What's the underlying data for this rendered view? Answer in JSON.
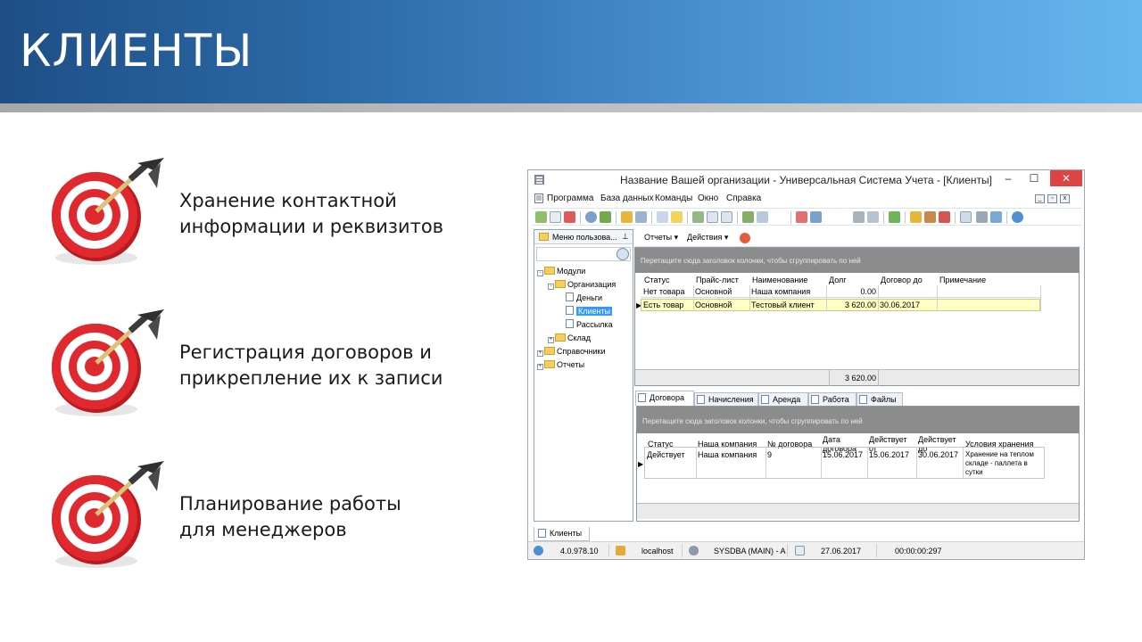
{
  "slide": {
    "title": "КЛИЕНТЫ"
  },
  "bullets": [
    {
      "line1": "Хранение контактной",
      "line2": "информации и реквизитов"
    },
    {
      "line1": "Регистрация договоров и",
      "line2": "прикрепление их к записи"
    },
    {
      "line1": "Планирование работы",
      "line2": "для менеджеров"
    }
  ],
  "window": {
    "title": "Название Вашей организации - Универсальная Система Учета - [Клиенты]",
    "minimize": "–",
    "maximize": "☐",
    "close": "✕",
    "menu": [
      "Программа",
      "База данных",
      "Команды",
      "Окно",
      "Справка"
    ]
  },
  "nav": {
    "header": "Меню пользова...",
    "tree": [
      {
        "label": "Модули"
      },
      {
        "label": "Организация"
      },
      {
        "label": "Деньги"
      },
      {
        "label": "Клиенты"
      },
      {
        "label": "Рассылка"
      },
      {
        "label": "Склад"
      },
      {
        "label": "Справочники"
      },
      {
        "label": "Отчеты"
      }
    ]
  },
  "subtoolbar": {
    "reports": "Отчеты ▾",
    "actions": "Действия ▾"
  },
  "grid1": {
    "group_hint": "Перетащите сюда заголовок колонки, чтобы сгруппировать по ней",
    "columns": [
      "Статус",
      "Прайс-лист",
      "Наименование",
      "Долг",
      "Договор до",
      "Примечание"
    ],
    "rows": [
      {
        "status": "Нет товара",
        "price": "Основной",
        "name": "Наша компания",
        "debt": "0.00",
        "contract": "",
        "note": ""
      },
      {
        "status": "Есть товар",
        "price": "Основной",
        "name": "Тестовый клиент",
        "debt": "3 620.00",
        "contract": "30.06.2017",
        "note": ""
      }
    ],
    "total": "3 620.00"
  },
  "detail_tabs": [
    "Договора",
    "Начисления",
    "Аренда",
    "Работа",
    "Файлы"
  ],
  "grid2": {
    "group_hint": "Перетащите сюда заголовок колонки, чтобы сгруппировать по ней",
    "columns": {
      "status": "Статус",
      "company": "Наша компания",
      "number": "№ договора",
      "date1": "Дата",
      "date2": "договора",
      "from1": "Действует",
      "from2": "от",
      "to1": "Действует",
      "to2": "до",
      "conditions": "Условия хранения"
    },
    "row": {
      "status": "Действует",
      "company": "Наша компания",
      "number": "9",
      "date": "15.06.2017",
      "from": "15.06.2017",
      "to": "30.06.2017",
      "cond1": "Хранение на теплом",
      "cond2": "складе - паллета в",
      "cond3": "сутки"
    }
  },
  "bottom_tab": "Клиенты",
  "status": {
    "version": "4.0.978.10",
    "host": "localhost",
    "user": "SYSDBA (MAIN) - A",
    "date": "27.06.2017",
    "time": "00:00:00:297"
  },
  "colors": {
    "header_start": "#1e4f86",
    "header_end": "#66b6ef",
    "target_red": "#d8262b",
    "selection": "#3399ff",
    "selected_row": "#ffffc2",
    "group_panel": "#8c8c8c"
  }
}
